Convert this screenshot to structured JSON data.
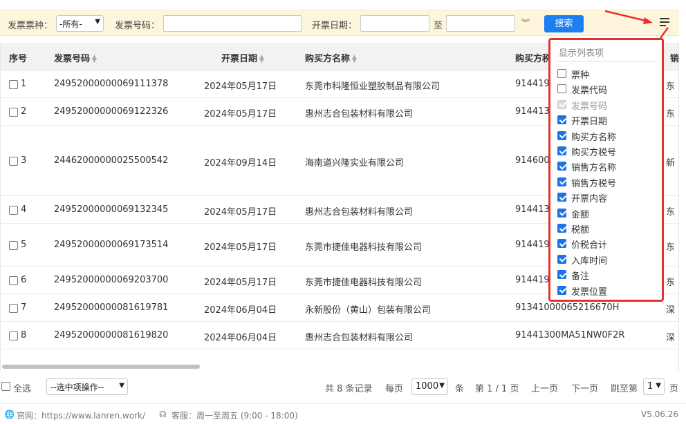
{
  "search": {
    "type_label": "发票票种：",
    "type_value": "-所有-",
    "number_label": "发票号码：",
    "number_value": "",
    "date_label": "开票日期：",
    "date_from": "",
    "date_sep": "至",
    "date_to": "",
    "button": "搜索"
  },
  "table": {
    "headers": [
      "序号",
      "发票号码",
      "开票日期",
      "购买方名称",
      "购买方税号"
    ],
    "headers_visible": [
      "序号",
      "发票号码",
      "开票日期",
      "购买方名称",
      "购买方税"
    ],
    "rows": [
      {
        "idx": "1",
        "number": "24952000000069111378",
        "date": "2024年05月17日",
        "buyer": "东莞市科隆恒业塑胶制品有限公司",
        "tax": "914419",
        "extra": "东"
      },
      {
        "idx": "2",
        "number": "24952000000069122326",
        "date": "2024年05月17日",
        "buyer": "惠州志合包装材料有限公司",
        "tax": "914413",
        "extra": "东"
      },
      {
        "idx": "3",
        "number": "24462000000025500542",
        "date": "2024年09月14日",
        "buyer": "海南道兴隆实业有限公司",
        "tax": "914600",
        "extra": "新"
      },
      {
        "idx": "4",
        "number": "24952000000069132345",
        "date": "2024年05月17日",
        "buyer": "惠州志合包装材料有限公司",
        "tax": "914413",
        "extra": "东"
      },
      {
        "idx": "5",
        "number": "24952000000069173514",
        "date": "2024年05月17日",
        "buyer": "东莞市捷佳电器科技有限公司",
        "tax": "914419",
        "extra": "东"
      },
      {
        "idx": "6",
        "number": "24952000000069203700",
        "date": "2024年05月17日",
        "buyer": "东莞市捷佳电器科技有限公司",
        "tax": "914419",
        "extra": "东"
      },
      {
        "idx": "7",
        "number": "24952000000081619781",
        "date": "2024年06月04日",
        "buyer": "永新股份（黄山）包装有限公司",
        "tax": "91341000065216670H",
        "extra": "深"
      },
      {
        "idx": "8",
        "number": "24952000000081619820",
        "date": "2024年06月04日",
        "buyer": "惠州志合包装材料有限公司",
        "tax": "91441300MA51NW0F2R",
        "extra": "深"
      }
    ],
    "header_extra": "销"
  },
  "columns_panel": {
    "title": "显示列表项",
    "items": [
      {
        "label": "票种",
        "checked": false,
        "disabled": false
      },
      {
        "label": "发票代码",
        "checked": false,
        "disabled": false
      },
      {
        "label": "发票号码",
        "checked": true,
        "disabled": true
      },
      {
        "label": "开票日期",
        "checked": true,
        "disabled": false
      },
      {
        "label": "购买方名称",
        "checked": true,
        "disabled": false
      },
      {
        "label": "购买方税号",
        "checked": true,
        "disabled": false
      },
      {
        "label": "销售方名称",
        "checked": true,
        "disabled": false
      },
      {
        "label": "销售方税号",
        "checked": true,
        "disabled": false
      },
      {
        "label": "开票内容",
        "checked": true,
        "disabled": false
      },
      {
        "label": "金额",
        "checked": true,
        "disabled": false
      },
      {
        "label": "税额",
        "checked": true,
        "disabled": false
      },
      {
        "label": "价税合计",
        "checked": true,
        "disabled": false
      },
      {
        "label": "入库时间",
        "checked": true,
        "disabled": false
      },
      {
        "label": "备注",
        "checked": true,
        "disabled": false
      },
      {
        "label": "发票位置",
        "checked": true,
        "disabled": false
      }
    ]
  },
  "pager": {
    "select_all": "全选",
    "bulk_action": "--选中项操作--",
    "total": "共 8 条记录",
    "per_page_label": "每页",
    "per_page_value": "1000",
    "per_page_unit": "条",
    "page_info": "第 1 / 1 页",
    "prev": "上一页",
    "next": "下一页",
    "jump_label": "跳至第",
    "jump_value": "1",
    "jump_unit": "页"
  },
  "footer": {
    "site": "官网：https://www.lanren.work/",
    "service": "客服：周一至周五 (9:00 - 18:00)",
    "version": "V5.06.26"
  },
  "colors": {
    "accent": "#1e7ff0",
    "highlight": "#e8312f",
    "searchbar_bg": "#fdf6dc"
  }
}
